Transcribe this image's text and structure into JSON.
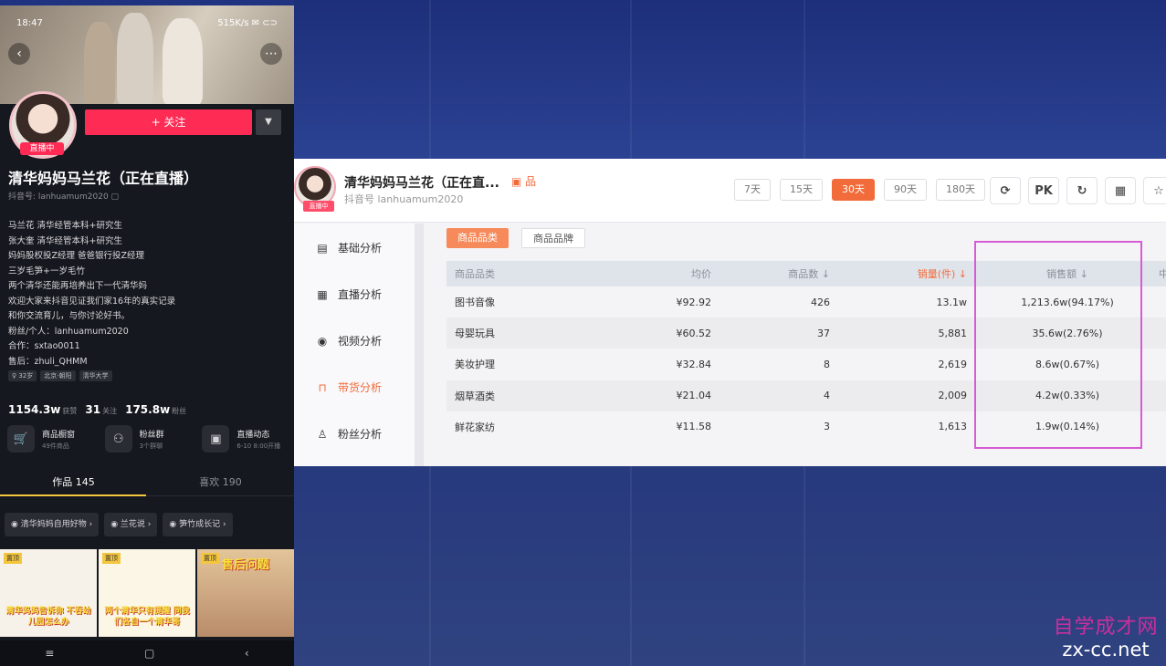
{
  "phone": {
    "status_time": "18:47",
    "status_right": "515K/s ✉ ⊂⊃",
    "follow_label": "+ 关注",
    "live_tag": "直播中",
    "name": "清华妈妈马兰花（正在直播）",
    "douyin_id": "抖音号: lanhuamum2020 ▢",
    "bio": [
      "马兰花 清华经管本科+研究生",
      "张大奎 清华经管本科+研究生",
      "妈妈股权投Z经理 爸爸银行投Z经理",
      "三岁毛笋+一岁毛竹",
      "两个清华还能再培养出下一代清华妈",
      "欢迎大家来抖音见证我们家16年的真实记录",
      "和你交流育儿，与你讨论好书。",
      "粉丝/个人：lanhuamum2020",
      "合作：sxtao0011",
      "售后：zhuli_QHMM"
    ],
    "tags": [
      "♀ 32岁",
      "北京·朝阳",
      "清华大学"
    ],
    "stats": [
      {
        "num": "1154.3w",
        "label": "获赞"
      },
      {
        "num": "31",
        "label": "关注"
      },
      {
        "num": "175.8w",
        "label": "粉丝"
      }
    ],
    "shop": [
      {
        "title": "商品橱窗",
        "sub": "49件商品",
        "icon": "🛒"
      },
      {
        "title": "粉丝群",
        "sub": "3个群聊",
        "icon": "⚇"
      },
      {
        "title": "直播动态",
        "sub": "6-10 8:00开播",
        "icon": "▣"
      }
    ],
    "tabs": [
      "作品 145",
      "喜欢 190"
    ],
    "collections": [
      "清华妈妈自用好物 ›",
      "兰花说 ›",
      "笋竹成长记 ›"
    ],
    "thumbs": [
      {
        "tag": "置顶",
        "caption": "清华妈妈告诉你 不吞幼儿园怎么办"
      },
      {
        "tag": "置顶",
        "caption": "两个清华只有提醒 同我们各自一个清华哥"
      },
      {
        "tag": "置顶",
        "caption": "售后问题"
      }
    ],
    "nav": [
      "≡",
      "▢",
      "‹"
    ]
  },
  "card": {
    "name": "清华妈妈马兰花（正在直...",
    "badge": "▣ 品",
    "sub": "抖音号 lanhuamum2020",
    "live_tag": "直播中",
    "ranges": [
      "7天",
      "15天",
      "30天",
      "90天",
      "180天"
    ],
    "active_range": "30天",
    "tools": [
      "⟳",
      "PK",
      "↻",
      "▦",
      "☆"
    ],
    "sidebar": [
      {
        "label": "基础分析",
        "icon": "▤"
      },
      {
        "label": "直播分析",
        "icon": "▦"
      },
      {
        "label": "视频分析",
        "icon": "◉"
      },
      {
        "label": "带货分析",
        "icon": "⊓"
      },
      {
        "label": "粉丝分析",
        "icon": "♙"
      }
    ],
    "segments": [
      "商品品类",
      "商品品牌"
    ],
    "table": {
      "headers": [
        "商品品类",
        "均价",
        "商品数 ↓",
        "销量(件) ↓",
        "销售额 ↓",
        "中"
      ],
      "rows": [
        [
          "图书音像",
          "¥92.92",
          "426",
          "13.1w",
          "1,213.6w(94.17%)"
        ],
        [
          "母婴玩具",
          "¥60.52",
          "37",
          "5,881",
          "35.6w(2.76%)"
        ],
        [
          "美妆护理",
          "¥32.84",
          "8",
          "2,619",
          "8.6w(0.67%)"
        ],
        [
          "烟草酒类",
          "¥21.04",
          "4",
          "2,009",
          "4.2w(0.33%)"
        ],
        [
          "鲜花家纺",
          "¥11.58",
          "3",
          "1,613",
          "1.9w(0.14%)"
        ]
      ]
    }
  },
  "watermark": {
    "line1": "自学成才网",
    "line2": "zx-cc.net"
  },
  "colors": {
    "accent": "#f26b3a",
    "live": "#fe2c55",
    "highlight": "#d65bd6"
  }
}
